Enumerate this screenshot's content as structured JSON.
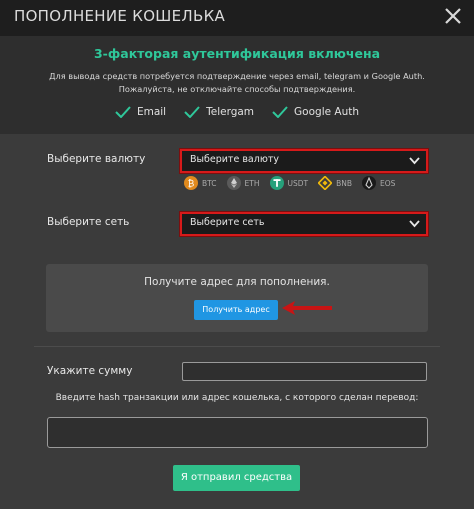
{
  "window": {
    "title": "ПОПОЛНЕНИЕ КОШЕЛЬКА"
  },
  "auth": {
    "title": "3-факторая аутентификация включена",
    "description": "Для вывода средств потребуется подтверждение через email, telegram и Google Auth. Пожалуйста, не отключайте способы подтверждения.",
    "methods": [
      "Email",
      "Telergam",
      "Google Auth"
    ],
    "accent_color": "#2fc79a"
  },
  "currency": {
    "label": "Выберите валюту",
    "selected": "Выберите валюту",
    "coins": [
      {
        "code": "BTC",
        "icon": "bitcoin-icon",
        "color": "#e08a1e"
      },
      {
        "code": "ETH",
        "icon": "ethereum-icon",
        "color": "#8c8c8c"
      },
      {
        "code": "USDT",
        "icon": "tether-icon",
        "color": "#26a17b"
      },
      {
        "code": "BNB",
        "icon": "binance-icon",
        "color": "#f0b90b"
      },
      {
        "code": "EOS",
        "icon": "eos-icon",
        "color": "#d0d0d0"
      }
    ]
  },
  "network": {
    "label": "Выберите сеть",
    "selected": "Выберите сеть"
  },
  "address": {
    "prompt": "Получите адрес для пополнения.",
    "button_label": "Получить адрес"
  },
  "amount": {
    "label": "Укажите сумму",
    "value": ""
  },
  "hash": {
    "label": "Введите hash транзакции или адрес кошелька, с которого сделан перевод:",
    "value": ""
  },
  "submit": {
    "label": "Я отправил средства",
    "color": "#2fbf8a"
  },
  "highlight_color": "#d61a1a"
}
